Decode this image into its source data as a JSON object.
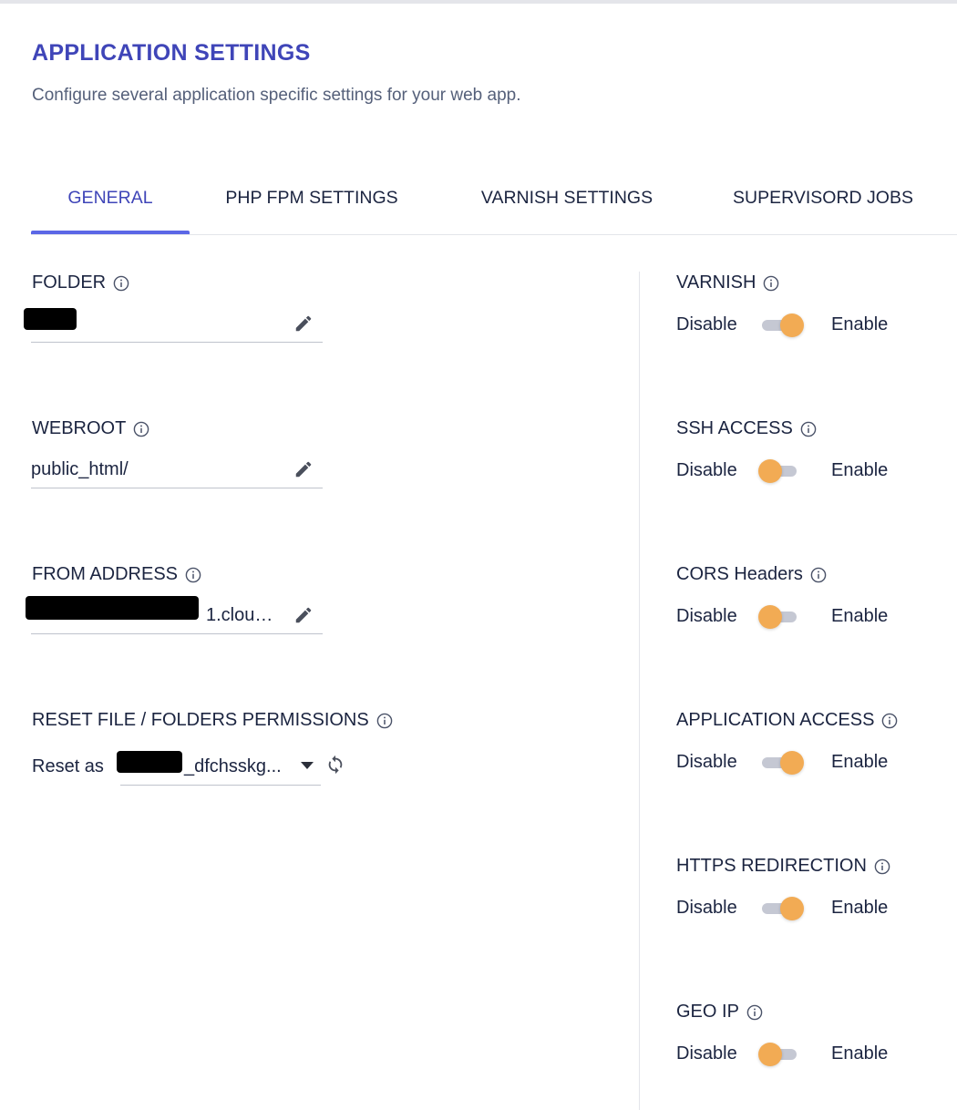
{
  "header": {
    "title": "APPLICATION SETTINGS",
    "subtitle": "Configure several application specific settings for your web app."
  },
  "tabs": [
    {
      "label": "GENERAL",
      "active": true
    },
    {
      "label": "PHP FPM SETTINGS",
      "active": false
    },
    {
      "label": "VARNISH SETTINGS",
      "active": false
    },
    {
      "label": "SUPERVISORD JOBS",
      "active": false
    }
  ],
  "general": {
    "folder": {
      "label": "FOLDER",
      "value": ""
    },
    "webroot": {
      "label": "WEBROOT",
      "value": "public_html/"
    },
    "from_address": {
      "label": "FROM ADDRESS",
      "value": "1.cloud..."
    },
    "reset_permissions": {
      "label": "RESET FILE / FOLDERS PERMISSIONS",
      "reset_as_label": "Reset as",
      "selected_value": "_dfchsskg..."
    }
  },
  "toggles": {
    "disable_text": "Disable",
    "enable_text": "Enable",
    "items": [
      {
        "label": "VARNISH",
        "enabled": true
      },
      {
        "label": "SSH ACCESS",
        "enabled": false
      },
      {
        "label": "CORS Headers",
        "enabled": false
      },
      {
        "label": "APPLICATION ACCESS",
        "enabled": true
      },
      {
        "label": "HTTPS REDIRECTION",
        "enabled": true
      },
      {
        "label": "GEO IP",
        "enabled": false
      }
    ]
  },
  "colors": {
    "title": "#3f45b8",
    "active_tab_underline": "#5b67e6",
    "toggle_knob": "#f2ab54",
    "toggle_track": "#c5c8d3"
  }
}
